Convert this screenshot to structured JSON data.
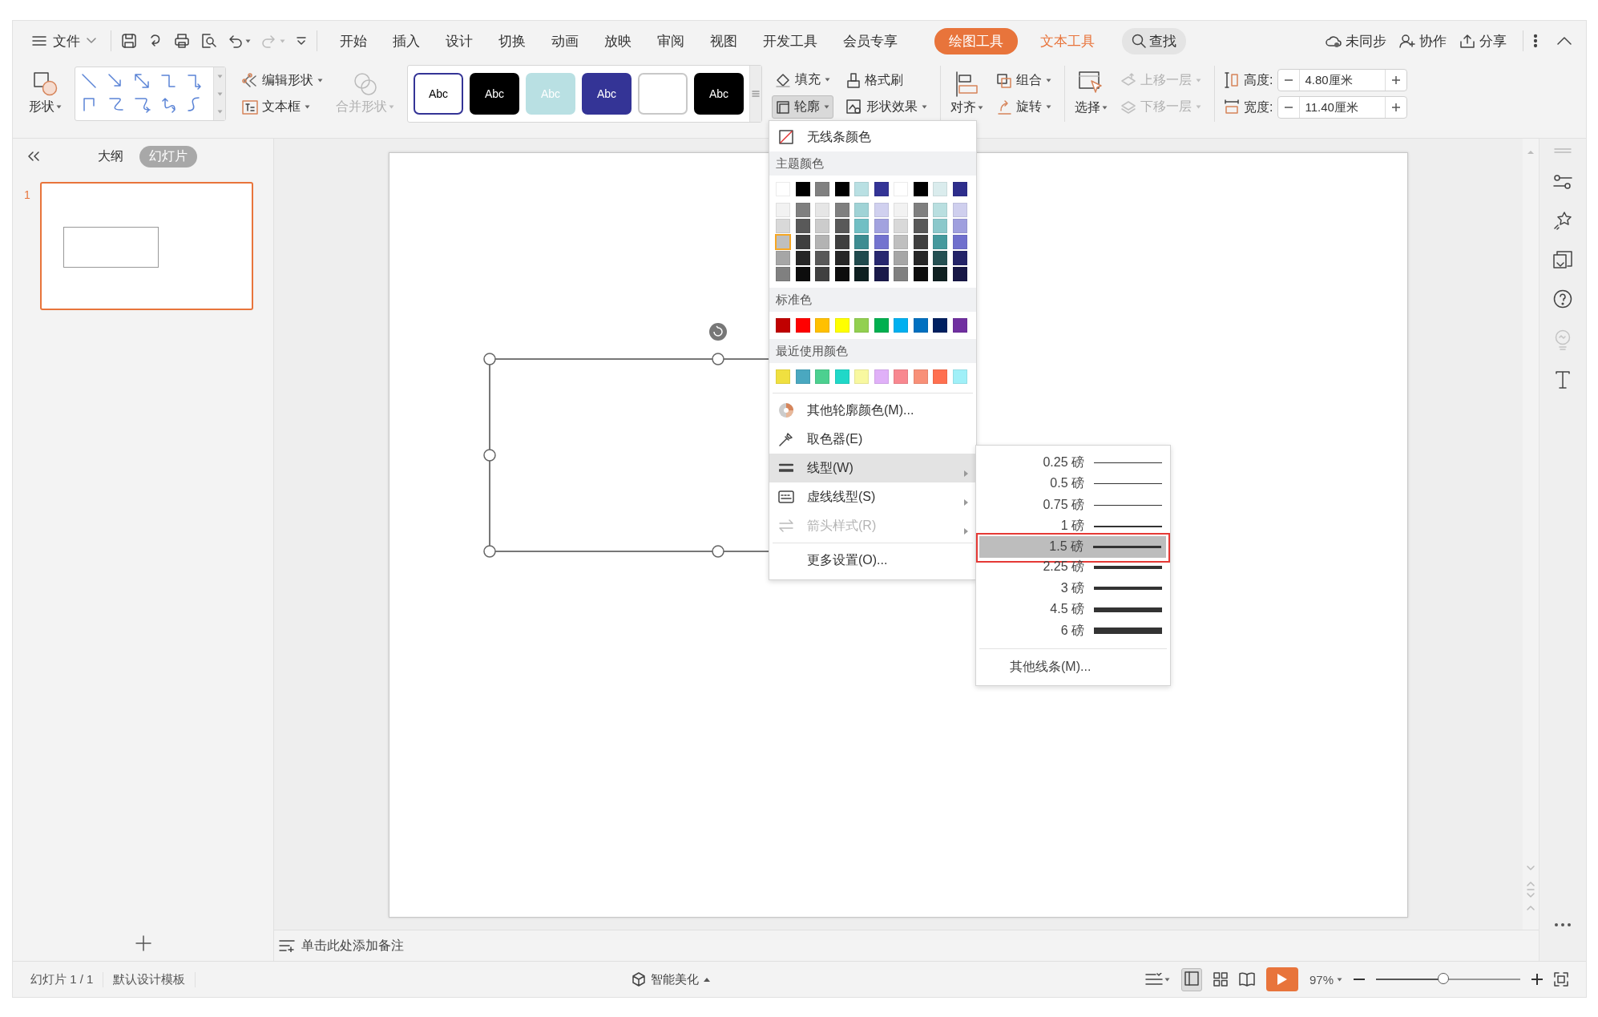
{
  "menu_bar": {
    "file_menu": "文件",
    "tabs": [
      {
        "label": "开始",
        "selected": false,
        "kind": "normal"
      },
      {
        "label": "插入",
        "selected": false,
        "kind": "normal"
      },
      {
        "label": "设计",
        "selected": false,
        "kind": "normal"
      },
      {
        "label": "切换",
        "selected": false,
        "kind": "normal"
      },
      {
        "label": "动画",
        "selected": false,
        "kind": "normal"
      },
      {
        "label": "放映",
        "selected": false,
        "kind": "normal"
      },
      {
        "label": "审阅",
        "selected": false,
        "kind": "normal"
      },
      {
        "label": "视图",
        "selected": false,
        "kind": "normal"
      },
      {
        "label": "开发工具",
        "selected": false,
        "kind": "normal"
      },
      {
        "label": "会员专享",
        "selected": false,
        "kind": "normal"
      },
      {
        "label": "绘图工具",
        "selected": true,
        "kind": "context"
      },
      {
        "label": "文本工具",
        "selected": false,
        "kind": "context"
      }
    ],
    "search": "查找",
    "sync": "未同步",
    "collaborate": "协作",
    "share": "分享"
  },
  "ribbon": {
    "shape": "形状",
    "edit_shape": "编辑形状",
    "text_box": "文本框",
    "merge_shapes": {
      "label": "合并形状",
      "disabled": true
    },
    "style_presets": [
      {
        "label": "Abc",
        "color": "#ffffff"
      },
      {
        "label": "Abc",
        "color": "#000000"
      },
      {
        "label": "Abc",
        "color": "#b9e0e3"
      },
      {
        "label": "Abc",
        "color": "#343496"
      },
      {
        "color": "#ffffff"
      },
      {
        "label": "Abc",
        "color": "#000000"
      }
    ],
    "fill": "填充",
    "format_painter": "格式刷",
    "outline": {
      "label": "轮廓",
      "expanded": true
    },
    "shape_effects": "形状效果",
    "align": "对齐",
    "group": "组合",
    "rotate": "旋转",
    "select": "选择",
    "bring_forward": {
      "label": "上移一层",
      "disabled": true
    },
    "send_backward": {
      "label": "下移一层",
      "disabled": true
    },
    "height": {
      "label": "高度:",
      "value": "4.80厘米"
    },
    "width": {
      "label": "宽度:",
      "value": "11.40厘米"
    }
  },
  "left_panel": {
    "tabs": [
      {
        "label": "大纲",
        "selected": false
      },
      {
        "label": "幻灯片",
        "selected": true
      }
    ],
    "slides": [
      {
        "number": "1",
        "selected": true
      }
    ]
  },
  "notes": {
    "placeholder": "单击此处添加备注"
  },
  "outline_menu": {
    "no_line": "无线条颜色",
    "theme_header": "主题颜色",
    "theme_colors": [
      {
        "color": "#ffffff",
        "selected": false
      },
      {
        "color": "#000000",
        "selected": false
      },
      {
        "color": "#808080",
        "selected": false
      },
      {
        "color": "#000000",
        "selected": false
      },
      {
        "color": "#b9e0e3",
        "selected": false
      },
      {
        "color": "#343496",
        "selected": false
      },
      {
        "color": "#ffffff",
        "selected": false
      },
      {
        "color": "#000000",
        "selected": false
      },
      {
        "color": "#daeced",
        "selected": false
      },
      {
        "color": "#2e2e8c",
        "selected": false
      }
    ],
    "theme_shades": [
      [
        {
          "color": "#f2f2f2",
          "selected": false
        },
        {
          "color": "#7f7f7f",
          "selected": false
        },
        {
          "color": "#e6e6e6",
          "selected": false
        },
        {
          "color": "#7f7f7f",
          "selected": false
        },
        {
          "color": "#a0d3d6",
          "selected": false
        },
        {
          "color": "#d0d0ef",
          "selected": false
        },
        {
          "color": "#f2f2f2",
          "selected": false
        },
        {
          "color": "#7f7f7f",
          "selected": false
        },
        {
          "color": "#b9dfe0",
          "selected": false
        },
        {
          "color": "#cfcfee",
          "selected": false
        }
      ],
      [
        {
          "color": "#d9d9d9",
          "selected": false
        },
        {
          "color": "#595959",
          "selected": false
        },
        {
          "color": "#cccccc",
          "selected": false
        },
        {
          "color": "#595959",
          "selected": false
        },
        {
          "color": "#71bfc4",
          "selected": false
        },
        {
          "color": "#a2a2df",
          "selected": false
        },
        {
          "color": "#d9d9d9",
          "selected": false
        },
        {
          "color": "#595959",
          "selected": false
        },
        {
          "color": "#8bc8cb",
          "selected": false
        },
        {
          "color": "#9f9fde",
          "selected": false
        }
      ],
      [
        {
          "color": "#bfbfbf",
          "selected": true
        },
        {
          "color": "#3f3f3f",
          "selected": false
        },
        {
          "color": "#b3b3b3",
          "selected": false
        },
        {
          "color": "#3f3f3f",
          "selected": false
        },
        {
          "color": "#3d8c91",
          "selected": false
        },
        {
          "color": "#7373cf",
          "selected": false
        },
        {
          "color": "#bfbfbf",
          "selected": false
        },
        {
          "color": "#3f3f3f",
          "selected": false
        },
        {
          "color": "#45999d",
          "selected": false
        },
        {
          "color": "#6f6fcd",
          "selected": false
        }
      ],
      [
        {
          "color": "#a6a6a6",
          "selected": false
        },
        {
          "color": "#262626",
          "selected": false
        },
        {
          "color": "#595959",
          "selected": false
        },
        {
          "color": "#262626",
          "selected": false
        },
        {
          "color": "#1f4a4d",
          "selected": false
        },
        {
          "color": "#27276f",
          "selected": false
        },
        {
          "color": "#a6a6a6",
          "selected": false
        },
        {
          "color": "#262626",
          "selected": false
        },
        {
          "color": "#245052",
          "selected": false
        },
        {
          "color": "#232368",
          "selected": false
        }
      ],
      [
        {
          "color": "#808080",
          "selected": false
        },
        {
          "color": "#0d0d0d",
          "selected": false
        },
        {
          "color": "#404040",
          "selected": false
        },
        {
          "color": "#0d0d0d",
          "selected": false
        },
        {
          "color": "#0d1f20",
          "selected": false
        },
        {
          "color": "#1a1a4a",
          "selected": false
        },
        {
          "color": "#808080",
          "selected": false
        },
        {
          "color": "#0d0d0d",
          "selected": false
        },
        {
          "color": "#0f2021",
          "selected": false
        },
        {
          "color": "#171746",
          "selected": false
        }
      ]
    ],
    "standard_header": "标准色",
    "standard_colors": [
      {
        "color": "#c00000",
        "selected": false
      },
      {
        "color": "#ff0000",
        "selected": false
      },
      {
        "color": "#ffc000",
        "selected": false
      },
      {
        "color": "#ffff00",
        "selected": false
      },
      {
        "color": "#92d050",
        "selected": false
      },
      {
        "color": "#00b050",
        "selected": false
      },
      {
        "color": "#00b0f0",
        "selected": false
      },
      {
        "color": "#0070c0",
        "selected": false
      },
      {
        "color": "#002060",
        "selected": false
      },
      {
        "color": "#7030a0",
        "selected": false
      }
    ],
    "recent_header": "最近使用颜色",
    "recent_colors": [
      {
        "color": "#f0e040",
        "selected": false
      },
      {
        "color": "#4aa8c0",
        "selected": false
      },
      {
        "color": "#4cd090",
        "selected": false
      },
      {
        "color": "#20d8c8",
        "selected": false
      },
      {
        "color": "#f8f8a0",
        "selected": false
      },
      {
        "color": "#e0b0f8",
        "selected": false
      },
      {
        "color": "#f88890",
        "selected": false
      },
      {
        "color": "#f89078",
        "selected": false
      },
      {
        "color": "#ff7050",
        "selected": false
      },
      {
        "color": "#a0f0f8",
        "selected": false
      }
    ],
    "items": [
      {
        "label": "其他轮廓颜色(M)...",
        "kind": "palette",
        "disabled": false,
        "highlighted": false
      },
      {
        "label": "取色器(E)",
        "kind": "eyedropper",
        "disabled": false,
        "highlighted": false
      },
      {
        "label": "线型(W)",
        "kind": "weight",
        "disabled": false,
        "highlighted": true
      },
      {
        "label": "虚线线型(S)",
        "kind": "dash",
        "disabled": false,
        "highlighted": false
      },
      {
        "label": "箭头样式(R)",
        "kind": "arrow",
        "disabled": true,
        "highlighted": false
      },
      {
        "label": "更多设置(O)...",
        "kind": "more",
        "disabled": false,
        "highlighted": false
      }
    ]
  },
  "line_weight_menu": {
    "options": [
      {
        "label": "0.25 磅",
        "selected": false
      },
      {
        "label": "0.5 磅",
        "selected": false
      },
      {
        "label": "0.75 磅",
        "selected": false
      },
      {
        "label": "1 磅",
        "selected": false
      },
      {
        "label": "1.5 磅",
        "selected": true
      },
      {
        "label": "2.25 磅",
        "selected": false
      },
      {
        "label": "3 磅",
        "selected": false
      },
      {
        "label": "4.5 磅",
        "selected": false
      },
      {
        "label": "6 磅",
        "selected": false
      }
    ],
    "more": "其他线条(M)..."
  },
  "status_bar": {
    "slide_counter": "幻灯片 1 / 1",
    "template": "默认设计模板",
    "beautify": "智能美化",
    "zoom": "97%",
    "zoom_slider": {
      "level": 0.47
    }
  }
}
